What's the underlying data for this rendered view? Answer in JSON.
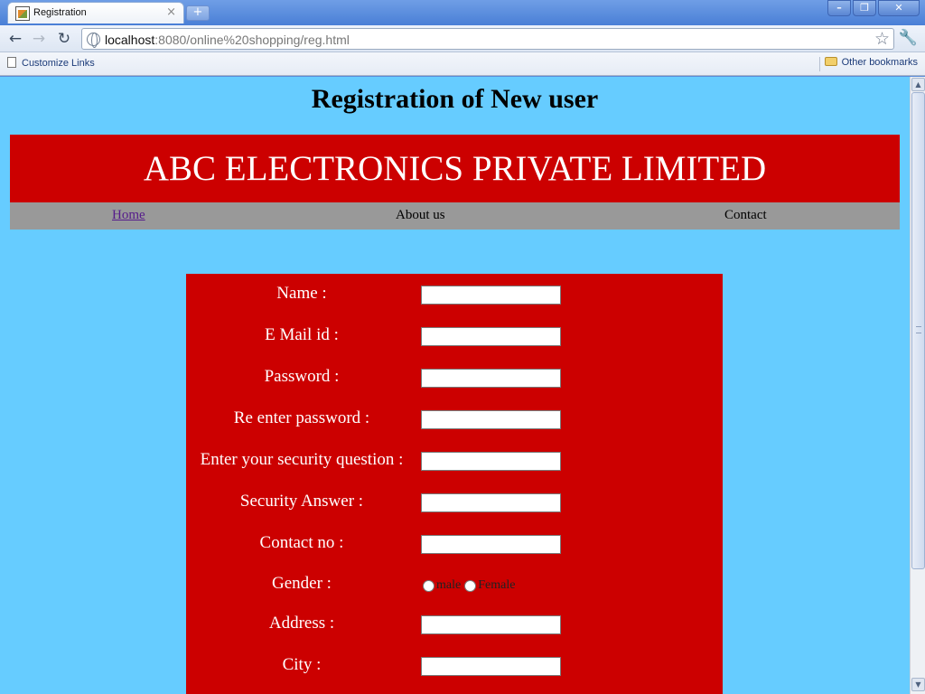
{
  "browser": {
    "tab_title": "Registration",
    "tab_close": "×",
    "new_tab": "+",
    "url_host": "localhost",
    "url_rest": ":8080/online%20shopping/reg.html",
    "bookmarks": {
      "left": "Customize Links",
      "right": "Other bookmarks"
    }
  },
  "page": {
    "heading": "Registration of New user",
    "banner": "ABC ELECTRONICS PRIVATE LIMITED",
    "nav": {
      "home": "Home",
      "about": "About us",
      "contact": "Contact"
    }
  },
  "form": {
    "name_label": "Name :",
    "email_label": "E Mail id :",
    "password_label": "Password :",
    "reenter_label": "Re enter password :",
    "question_label": "Enter your security question :",
    "answer_label": "Security Answer :",
    "contact_label": "Contact no :",
    "gender_label": "Gender :",
    "gender_male": "male",
    "gender_female": "Female",
    "address_label": "Address :",
    "city_label": "City :"
  },
  "colors": {
    "page_bg": "#66ccff",
    "banner_bg": "#cc0000",
    "nav_bg": "#999999",
    "form_bg": "#cc0000"
  }
}
